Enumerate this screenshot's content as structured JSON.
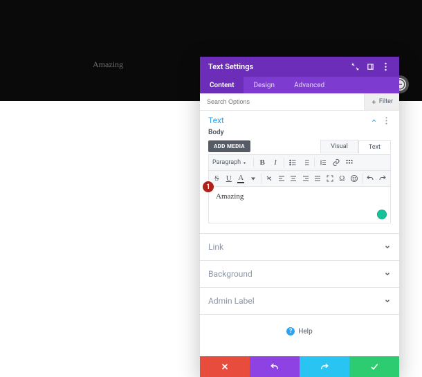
{
  "backdrop": {
    "preview_text": "Amazing"
  },
  "panel": {
    "title": "Text Settings",
    "tabs": [
      "Content",
      "Design",
      "Advanced"
    ],
    "active_tab": 0,
    "search_placeholder": "Search Options",
    "filter_label": "Filter"
  },
  "section_text": {
    "title": "Text",
    "body_label": "Body",
    "add_media": "ADD MEDIA",
    "tabs": {
      "visual": "Visual",
      "text": "Text"
    },
    "paragraph_label": "Paragraph",
    "editor_content": "Amazing",
    "marker": "1"
  },
  "collapsed_sections": [
    "Link",
    "Background",
    "Admin Label"
  ],
  "help_label": "Help"
}
